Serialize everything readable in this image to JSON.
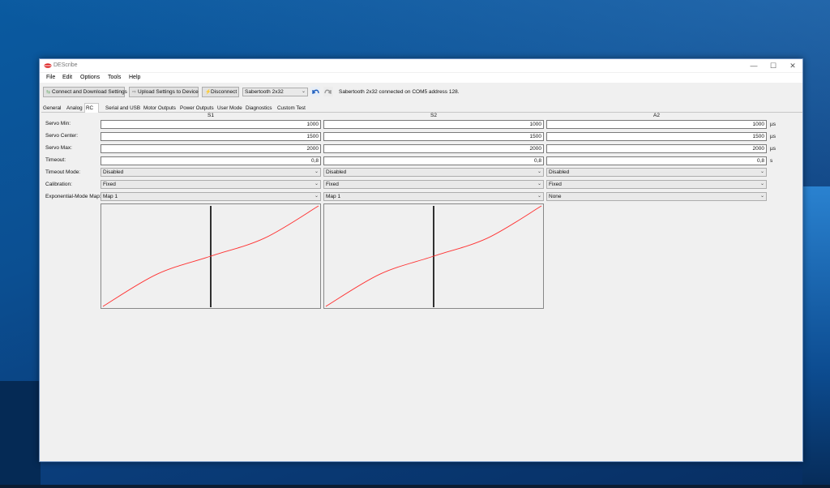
{
  "window": {
    "title": "DEScribe",
    "minimize": "—",
    "maximize": "☐",
    "close": "✕"
  },
  "menu": [
    "File",
    "Edit",
    "Options",
    "Tools",
    "Help"
  ],
  "toolbar": {
    "connect_label": "Connect and Download Settings",
    "upload_label": "Upload Settings to Device",
    "disconnect_label": "Disconnect",
    "device_selected": "Sabertooth 2x32",
    "status": "Sabertooth 2x32 connected on COM5 address 128."
  },
  "tabs": [
    "General",
    "Analog",
    "RC",
    "Serial and USB",
    "Motor Outputs",
    "Power Outputs",
    "User Mode",
    "Diagnostics",
    "Custom Test"
  ],
  "active_tab": "RC",
  "columns": [
    "S1",
    "S2",
    "A2"
  ],
  "labels": {
    "servo_min": "Servo Min:",
    "servo_center": "Servo Center:",
    "servo_max": "Servo Max:",
    "timeout": "Timeout:",
    "timeout_mode": "Timeout Mode:",
    "calibration": "Calibration:",
    "exp_map": "Exponential-Mode Map:"
  },
  "units": {
    "us": "µs",
    "s": "s"
  },
  "values": {
    "s1": {
      "servo_min": "1000",
      "servo_center": "1500",
      "servo_max": "2000",
      "timeout": "0,8",
      "timeout_mode": "Disabled",
      "calibration": "Fixed",
      "exp_map": "Map 1"
    },
    "s2": {
      "servo_min": "1000",
      "servo_center": "1500",
      "servo_max": "2000",
      "timeout": "0,8",
      "timeout_mode": "Disabled",
      "calibration": "Fixed",
      "exp_map": "Map 1"
    },
    "a2": {
      "servo_min": "1000",
      "servo_center": "1500",
      "servo_max": "2000",
      "timeout": "0,8",
      "timeout_mode": "Disabled",
      "calibration": "Fixed",
      "exp_map": "None"
    }
  },
  "colors": {
    "curve": "#ff3030",
    "marker": "#000000"
  },
  "curve": {
    "type": "line",
    "x": [
      0,
      0.25,
      0.5,
      0.75,
      1.0
    ],
    "y": [
      0,
      0.32,
      0.5,
      0.68,
      1.0
    ],
    "marker_position": 0.5
  }
}
